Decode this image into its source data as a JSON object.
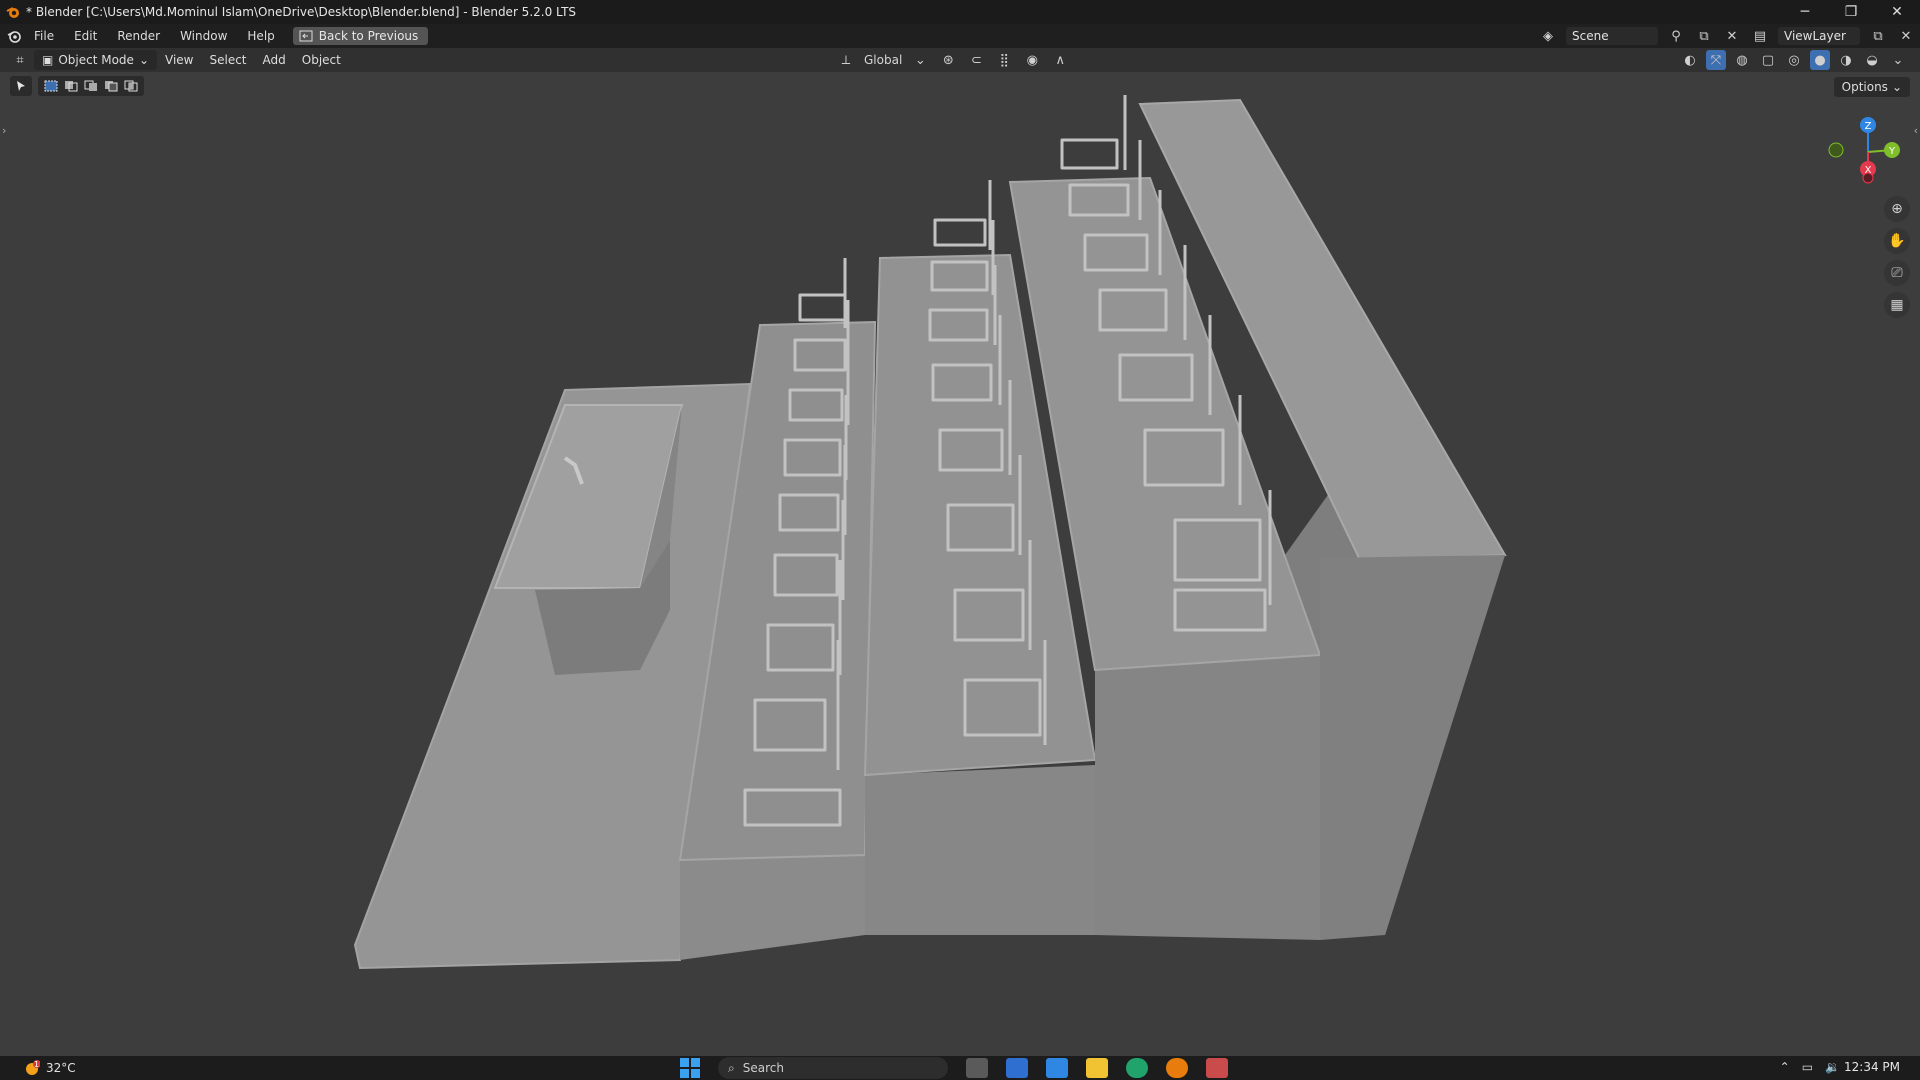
{
  "window": {
    "title": "* Blender [C:\\Users\\Md.Mominul Islam\\OneDrive\\Desktop\\Blender.blend] - Blender 5.2.0 LTS",
    "controls": [
      "minimize",
      "restore",
      "close"
    ]
  },
  "menubar": {
    "items": [
      "File",
      "Edit",
      "Render",
      "Window",
      "Help"
    ],
    "back_button": "Back to Previous",
    "scene": "Scene",
    "view_layer": "ViewLayer"
  },
  "viewport_header": {
    "mode": "Object Mode",
    "menus": [
      "View",
      "Select",
      "Add",
      "Object"
    ],
    "transform_orientation": "Global"
  },
  "toolbar": {
    "options_label": "Options"
  },
  "gizmo": {
    "axes": [
      "Z",
      "Y",
      "X"
    ],
    "colors": {
      "x": "#e53a4d",
      "y": "#7fbf2a",
      "z": "#2f87e3"
    }
  },
  "taskbar": {
    "weather": "32°C",
    "weather_badge": "1",
    "search_placeholder": "Search",
    "time": "12:34 PM"
  },
  "viewport": {
    "background": "#3d3d3d",
    "model_color": "#8f8f8f"
  }
}
